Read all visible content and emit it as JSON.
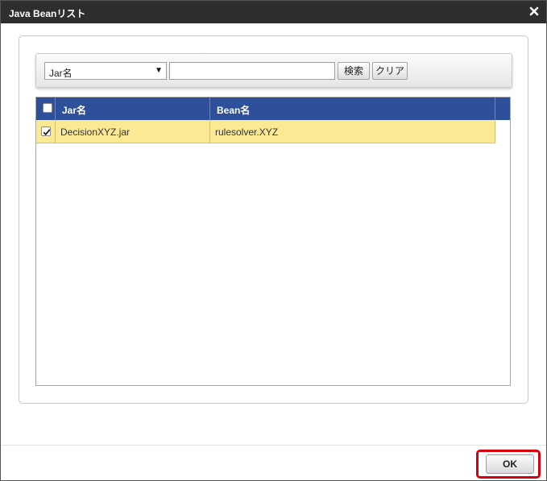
{
  "dialog": {
    "title": "Java Beanリスト",
    "close_icon": "close-icon"
  },
  "search": {
    "select_value": "Jar名",
    "input_value": "",
    "search_label": "検索",
    "clear_label": "クリア"
  },
  "grid": {
    "columns": [
      "Jar名",
      "Bean名"
    ],
    "rows": [
      {
        "checked": true,
        "jar": "DecisionXYZ.jar",
        "bean": "rulesolver.XYZ"
      }
    ]
  },
  "footer": {
    "ok_label": "OK"
  },
  "colors": {
    "titlebar": "#2e2e2e",
    "header": "#2e4f9a",
    "selected_row": "#fbe993",
    "highlight": "#d9000e"
  }
}
